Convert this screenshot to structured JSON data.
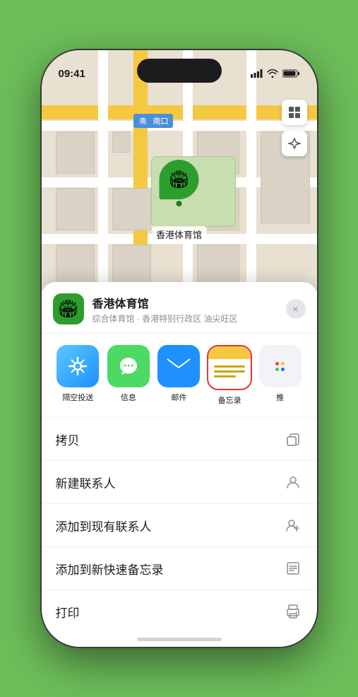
{
  "status_bar": {
    "time": "09:41",
    "location_icon": "▶"
  },
  "map": {
    "label_text": "南口",
    "label_prefix": "南"
  },
  "location_pin": {
    "label": "香港体育馆"
  },
  "venue_sheet": {
    "name": "香港体育馆",
    "subtitle": "综合体育馆 · 香港特别行政区 油尖旺区",
    "close_label": "×"
  },
  "apps": [
    {
      "id": "airdrop",
      "label": "隔空投送"
    },
    {
      "id": "messages",
      "label": "信息"
    },
    {
      "id": "mail",
      "label": "邮件"
    },
    {
      "id": "notes",
      "label": "备忘录"
    },
    {
      "id": "more",
      "label": "推"
    }
  ],
  "actions": [
    {
      "id": "copy",
      "label": "拷贝",
      "icon": "copy"
    },
    {
      "id": "new-contact",
      "label": "新建联系人",
      "icon": "person"
    },
    {
      "id": "add-contact",
      "label": "添加到现有联系人",
      "icon": "person-add"
    },
    {
      "id": "quick-note",
      "label": "添加到新快速备忘录",
      "icon": "note"
    },
    {
      "id": "print",
      "label": "打印",
      "icon": "print"
    }
  ]
}
